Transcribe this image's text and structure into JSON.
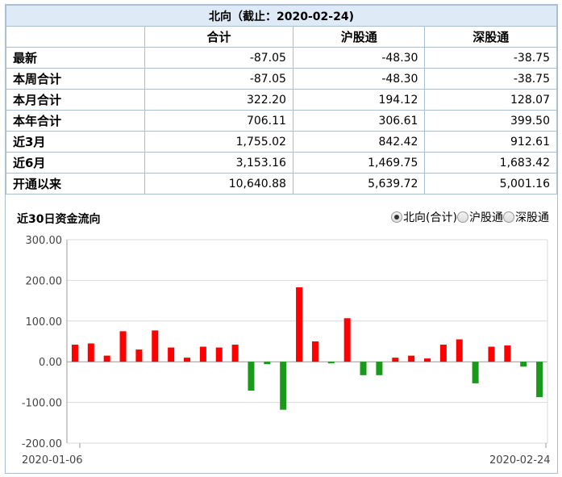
{
  "table": {
    "caption": "北向（截止：2020-02-24)",
    "headers": [
      "",
      "合计",
      "沪股通",
      "深股通"
    ],
    "rows": [
      {
        "label": "最新",
        "total": "-87.05",
        "sh": "-48.30",
        "sz": "-38.75"
      },
      {
        "label": "本周合计",
        "total": "-87.05",
        "sh": "-48.30",
        "sz": "-38.75"
      },
      {
        "label": "本月合计",
        "total": "322.20",
        "sh": "194.12",
        "sz": "128.07"
      },
      {
        "label": "本年合计",
        "total": "706.11",
        "sh": "306.61",
        "sz": "399.50"
      },
      {
        "label": "近3月",
        "total": "1,755.02",
        "sh": "842.42",
        "sz": "912.61"
      },
      {
        "label": "近6月",
        "total": "3,153.16",
        "sh": "1,469.75",
        "sz": "1,683.42"
      },
      {
        "label": "开通以来",
        "total": "10,640.88",
        "sh": "5,639.72",
        "sz": "5,001.16"
      }
    ]
  },
  "chart_section": {
    "title": "近30日资金流向",
    "options": [
      {
        "label": "北向(合计)",
        "checked": true
      },
      {
        "label": "沪股通",
        "checked": false
      },
      {
        "label": "深股通",
        "checked": false
      }
    ]
  },
  "chart_data": {
    "type": "bar",
    "title": "近30日资金流向",
    "x_start_label": "2020-01-06",
    "x_end_label": "2020-02-24",
    "ylim": [
      -200,
      300
    ],
    "yticks": [
      "300.00",
      "200.00",
      "100.00",
      "0.00",
      "-100.00",
      "-200.00"
    ],
    "grid": true,
    "positive_color": "#ff0000",
    "negative_color": "#1a9a1a",
    "values": [
      42,
      45,
      15,
      75,
      30,
      77,
      35,
      10,
      37,
      35,
      42,
      -71,
      -6,
      -118,
      183,
      50,
      -4,
      107,
      -33,
      -33,
      10,
      15,
      8,
      42,
      55,
      -53,
      37,
      40,
      -12,
      -87
    ]
  }
}
